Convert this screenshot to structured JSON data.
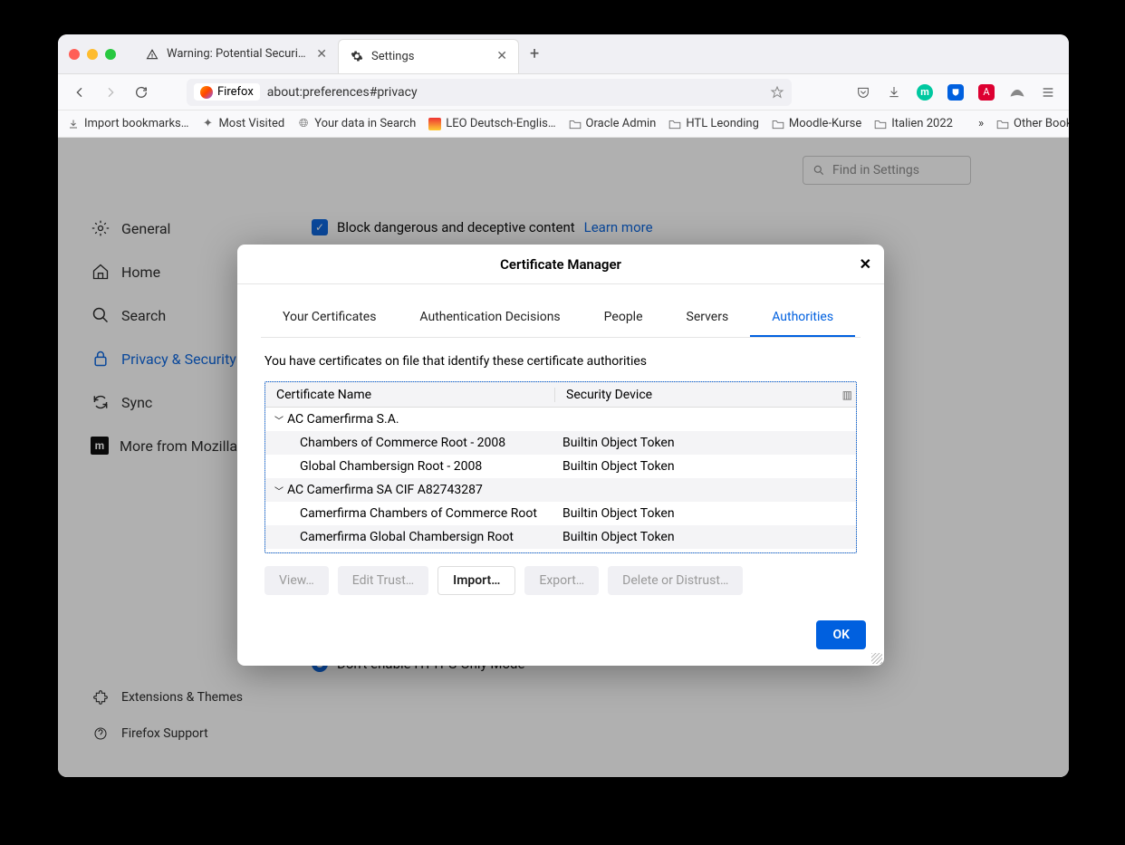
{
  "tabs": [
    {
      "label": "Warning: Potential Security Risk",
      "active": false
    },
    {
      "label": "Settings",
      "active": true
    }
  ],
  "url": {
    "badge": "Firefox",
    "address": "about:preferences#privacy"
  },
  "bookmarks": [
    "Import bookmarks…",
    "Most Visited",
    "Your data in Search",
    "LEO Deutsch-Englis…",
    "Oracle Admin",
    "HTL Leonding",
    "Moodle-Kurse",
    "Italien 2022"
  ],
  "otherBookmarks": "Other Bookmarks",
  "findPlaceholder": "Find in Settings",
  "sidebar": {
    "items": [
      {
        "label": "General"
      },
      {
        "label": "Home"
      },
      {
        "label": "Search"
      },
      {
        "label": "Privacy & Security",
        "active": true
      },
      {
        "label": "Sync"
      },
      {
        "label": "More from Mozilla"
      }
    ],
    "bottom": [
      {
        "label": "Extensions & Themes"
      },
      {
        "label": "Firefox Support"
      }
    ]
  },
  "main": {
    "blockLabel": "Block dangerous and deceptive content",
    "learnMore": "Learn more",
    "httpsLabel": "Don't enable HTTPS-Only Mode"
  },
  "modal": {
    "title": "Certificate Manager",
    "tabs": [
      "Your Certificates",
      "Authentication Decisions",
      "People",
      "Servers",
      "Authorities"
    ],
    "activeTab": "Authorities",
    "description": "You have certificates on file that identify these certificate authorities",
    "columns": [
      "Certificate Name",
      "Security Device"
    ],
    "rows": [
      {
        "type": "group",
        "name": "AC Camerfirma S.A."
      },
      {
        "type": "cert",
        "name": "Chambers of Commerce Root - 2008",
        "device": "Builtin Object Token",
        "alt": true
      },
      {
        "type": "cert",
        "name": "Global Chambersign Root - 2008",
        "device": "Builtin Object Token"
      },
      {
        "type": "group",
        "name": "AC Camerfirma SA CIF A82743287",
        "alt": true
      },
      {
        "type": "cert",
        "name": "Camerfirma Chambers of Commerce Root",
        "device": "Builtin Object Token"
      },
      {
        "type": "cert",
        "name": "Camerfirma Global Chambersign Root",
        "device": "Builtin Object Token",
        "alt": true
      }
    ],
    "buttons": {
      "view": "View…",
      "edit": "Edit Trust…",
      "import": "Import…",
      "export": "Export…",
      "delete": "Delete or Distrust…",
      "ok": "OK"
    }
  }
}
